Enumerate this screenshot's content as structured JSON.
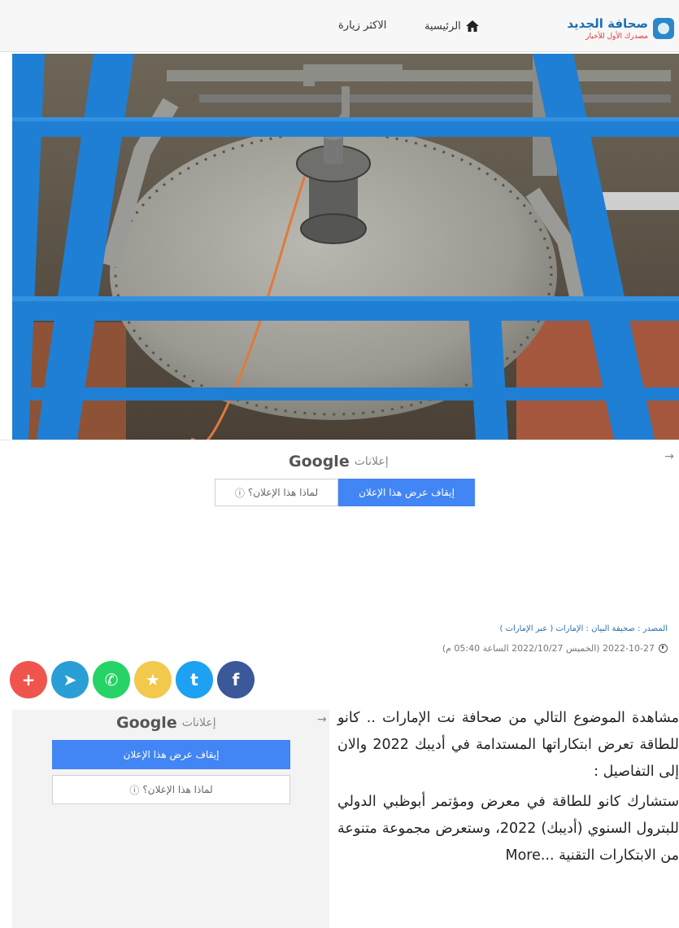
{
  "header": {
    "logo_title": "صحافة الجديد",
    "logo_subtitle": "مصدرك الأول للأخبار",
    "nav": [
      {
        "label": "الرئيسية",
        "icon": "home-icon"
      },
      {
        "label": "الاكثر زيارة"
      }
    ]
  },
  "hero": {
    "icon": "heat-exchanger-photo"
  },
  "ad_top": {
    "arrow": "→",
    "google": "Google",
    "ads_word": "إعلانات",
    "stop_button": "إيقاف عرض هذا الإعلان",
    "why_button": "لماذا هذا الإعلان؟",
    "info_icon": "ⓘ"
  },
  "article_meta": {
    "source": "المصدر : صحيفة البيان : الإمارات ( عبر الإمارات )",
    "datetime": "2022-10-27 (الخميس 2022/10/27 الساعة 05:40 م)"
  },
  "share": {
    "buttons": [
      {
        "name": "facebook",
        "glyph": "f",
        "color": "#3b5998"
      },
      {
        "name": "twitter",
        "glyph": "t",
        "color": "#1da1f2"
      },
      {
        "name": "favorite",
        "glyph": "★",
        "color": "#f2c94c"
      },
      {
        "name": "whatsapp",
        "glyph": "✆",
        "color": "#25d366"
      },
      {
        "name": "telegram",
        "glyph": "➤",
        "color": "#2a9fd6"
      },
      {
        "name": "more",
        "glyph": "+",
        "color": "#f0554d"
      }
    ]
  },
  "ad_side": {
    "arrow": "→",
    "google": "Google",
    "ads_word": "إعلانات",
    "stop_button": "إيقاف عرض هذا الإعلان",
    "why_button": "لماذا هذا الإعلان؟",
    "info_icon": "ⓘ"
  },
  "article": {
    "paragraph_1": "مشاهدة الموضوع التالي من صحافة نت الإمارات .. كانو للطاقة تعرض ابتكاراتها المستدامة في أديبك 2022 والان إلى التفاصيل :",
    "paragraph_2": "ستشارك كانو للطاقة في معرض ومؤتمر أبوظبي الدولي للبترول السنوي (أديبك) 2022، وستعرض مجموعة متنوعة من الابتكارات التقنية",
    "more_link": "More..."
  }
}
